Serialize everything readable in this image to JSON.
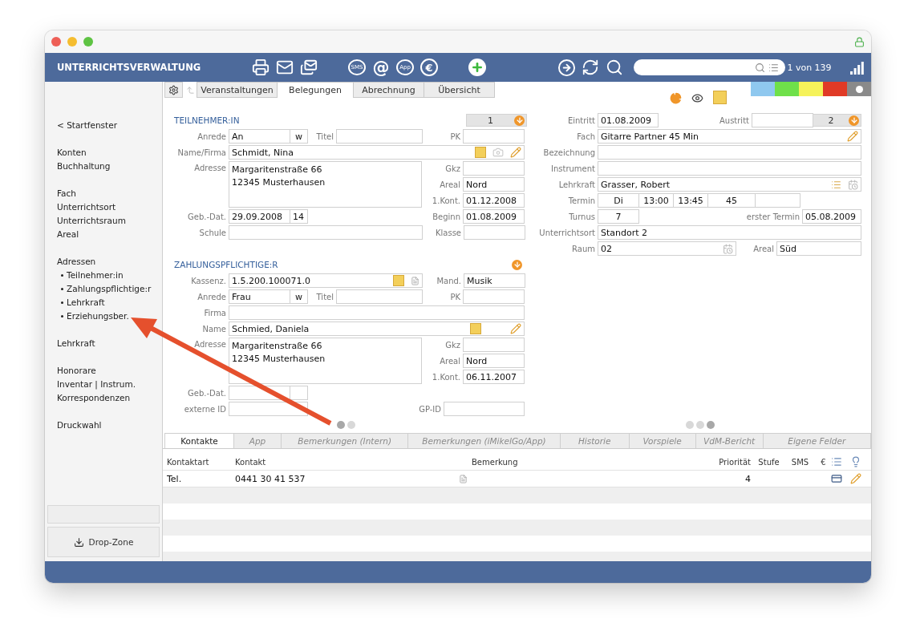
{
  "header": {
    "title": "UNTERRICHTSVERWALTUNG",
    "toolbar": [
      [
        {
          "kind": "printer"
        },
        {
          "kind": "mail"
        },
        {
          "kind": "mails"
        }
      ],
      [
        {
          "kind": "bubble",
          "label": "SMS"
        },
        {
          "kind": "glyph",
          "label": "@"
        },
        {
          "kind": "bubble",
          "label": "App"
        },
        {
          "kind": "coin",
          "label": "€"
        }
      ],
      [
        {
          "kind": "add"
        }
      ],
      [
        {
          "kind": "forward"
        },
        {
          "kind": "refresh"
        },
        {
          "kind": "search"
        }
      ]
    ],
    "record_count": "1 von 139"
  },
  "tabs": [
    {
      "label": "Veranstaltungen",
      "selected": false
    },
    {
      "label": "Belegungen",
      "selected": true
    },
    {
      "label": "Abrechnung",
      "selected": false
    },
    {
      "label": "Übersicht",
      "selected": false
    }
  ],
  "swatches": [
    {
      "color": "#8fc8ef",
      "selected": false
    },
    {
      "color": "#6fe04a",
      "selected": false
    },
    {
      "color": "#f5f25a",
      "selected": false
    },
    {
      "color": "#e03a26",
      "selected": false
    },
    {
      "color": "#8a8a8a",
      "selected": true
    }
  ],
  "sidebar": {
    "groups": [
      [
        {
          "label": "< Startfenster"
        }
      ],
      [
        {
          "label": "Konten"
        },
        {
          "label": "Buchhaltung"
        }
      ],
      [
        {
          "label": "Fach"
        },
        {
          "label": "Unterrichtsort"
        },
        {
          "label": "Unterrichtsraum"
        },
        {
          "label": "Areal"
        }
      ],
      [
        {
          "label": "Adressen",
          "children": [
            {
              "label": "Teilnehmer:in"
            },
            {
              "label": "Zahlungspflichtige:r"
            },
            {
              "label": "Lehrkraft"
            },
            {
              "label": "Erziehungsber."
            }
          ]
        }
      ],
      [
        {
          "label": "Lehrkraft"
        }
      ],
      [
        {
          "label": "Honorare"
        },
        {
          "label": "Inventar | Instrum."
        },
        {
          "label": "Korrespondenzen"
        }
      ],
      [
        {
          "label": "Druckwahl"
        }
      ]
    ],
    "drop_zone": "Drop-Zone"
  },
  "participant": {
    "heading": "TEILNEHMER:IN",
    "counter": "1",
    "anrede": {
      "label": "Anrede",
      "value": "An",
      "gender": "w"
    },
    "titel": {
      "label": "Titel"
    },
    "pk": {
      "label": "PK"
    },
    "name": {
      "label": "Name/Firma",
      "value": "Schmidt, Nina"
    },
    "adresse": {
      "label": "Adresse",
      "lines": [
        "Margaritenstraße 66",
        "12345 Musterhausen"
      ]
    },
    "gkz": {
      "label": "Gkz"
    },
    "areal": {
      "label": "Areal",
      "value": "Nord"
    },
    "kont": {
      "label": "1.Kont.",
      "value": "01.12.2008"
    },
    "geb": {
      "label": "Geb.-Dat.",
      "value": "29.09.2008",
      "age": "14"
    },
    "beginn": {
      "label": "Beginn",
      "value": "01.08.2009"
    },
    "schule": {
      "label": "Schule"
    },
    "klasse": {
      "label": "Klasse"
    }
  },
  "payer": {
    "heading": "ZAHLUNGSPFLICHTIGE:R",
    "kassenz": {
      "label": "Kassenz.",
      "value": "1.5.200.100071.0"
    },
    "mand": {
      "label": "Mand.",
      "value": "Musik"
    },
    "anrede": {
      "label": "Anrede",
      "value": "Frau",
      "gender": "w"
    },
    "titel": {
      "label": "Titel"
    },
    "pk": {
      "label": "PK"
    },
    "firma": {
      "label": "Firma"
    },
    "name": {
      "label": "Name",
      "value": "Schmied, Daniela"
    },
    "adresse": {
      "label": "Adresse",
      "lines": [
        "Margaritenstraße 66",
        "12345 Musterhausen"
      ]
    },
    "gkz": {
      "label": "Gkz"
    },
    "areal": {
      "label": "Areal",
      "value": "Nord"
    },
    "kont": {
      "label": "1.Kont.",
      "value": "06.11.2007"
    },
    "geb": {
      "label": "Geb.-Dat."
    },
    "externe_id": {
      "label": "externe ID"
    },
    "gp_id": {
      "label": "GP-ID"
    }
  },
  "booking": {
    "eintritt": {
      "label": "Eintritt",
      "value": "01.08.2009"
    },
    "austritt": {
      "label": "Austritt"
    },
    "counter": "2",
    "fach": {
      "label": "Fach",
      "value": "Gitarre Partner 45 Min"
    },
    "bezeichnung": {
      "label": "Bezeichnung"
    },
    "instrument": {
      "label": "Instrument"
    },
    "lehrkraft": {
      "label": "Lehrkraft",
      "value": "Grasser, Robert"
    },
    "termin": {
      "label": "Termin",
      "cells": [
        "Di",
        "13:00",
        "13:45",
        "45"
      ]
    },
    "turnus": {
      "label": "Turnus",
      "value": "7"
    },
    "erster_termin": {
      "label": "erster Termin",
      "value": "05.08.2009"
    },
    "unterrichtsort": {
      "label": "Unterrichtsort",
      "value": "Standort 2"
    },
    "raum": {
      "label": "Raum",
      "value": "02"
    },
    "areal": {
      "label": "Areal",
      "value": "Süd"
    }
  },
  "left_pager": [
    {
      "selected": true
    },
    {
      "selected": false
    }
  ],
  "right_pager": [
    {
      "selected": false
    },
    {
      "selected": false
    },
    {
      "selected": true
    }
  ],
  "bottom_tabs": [
    {
      "label": "Kontakte",
      "selected": true
    },
    {
      "label": "App",
      "selected": false
    },
    {
      "label": "Bemerkungen (Intern)",
      "selected": false
    },
    {
      "label": "Bemerkungen (iMikelGo/App)",
      "selected": false
    },
    {
      "label": "Historie",
      "selected": false
    },
    {
      "label": "Vorspiele",
      "selected": false
    },
    {
      "label": "VdM-Bericht",
      "selected": false
    },
    {
      "label": "Eigene Felder",
      "selected": false
    }
  ],
  "contacts": {
    "columns": [
      "Kontaktart",
      "Kontakt",
      "Bemerkung",
      "Priorität",
      "Stufe",
      "SMS",
      "€"
    ],
    "rows": [
      {
        "type": "Tel.",
        "contact": "0441 30 41 537",
        "priority": "4"
      }
    ]
  }
}
